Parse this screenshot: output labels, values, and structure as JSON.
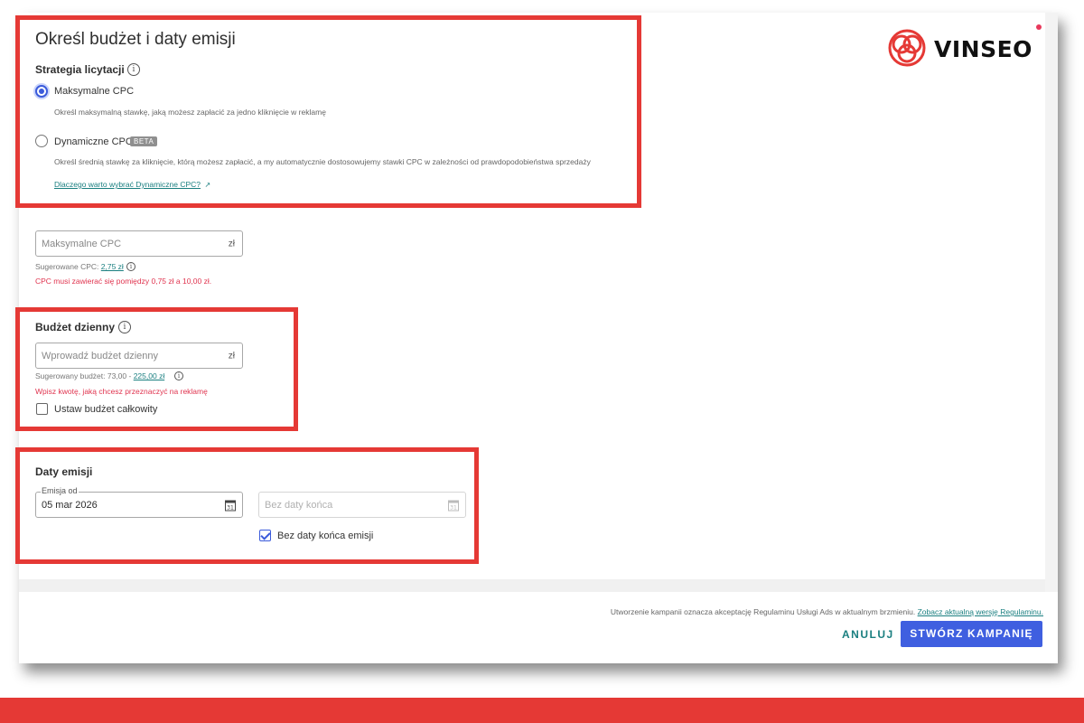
{
  "brand": {
    "name": "VINSEO",
    "accent": "#e53935",
    "dot_color": "#e8385b"
  },
  "page": {
    "title": "Określ budżet i daty emisji"
  },
  "strategy": {
    "title": "Strategia licytacji",
    "options": [
      {
        "label": "Maksymalne CPC",
        "description": "Określ maksymalną stawkę, jaką możesz zapłacić za jedno kliknięcie w reklamę",
        "selected": true
      },
      {
        "label": "Dynamiczne CPC",
        "badge": "BETA",
        "description": "Określ średnią stawkę za kliknięcie, którą możesz zapłacić, a my automatycznie dostosowujemy stawki CPC w zależności od prawdopodobieństwa sprzedaży",
        "selected": false,
        "link": "Dlaczego warto wybrać Dynamiczne CPC?"
      }
    ]
  },
  "max_cpc": {
    "placeholder": "Maksymalne CPC",
    "currency": "zł",
    "suggested_label": "Sugerowane CPC:",
    "suggested_value": "2,75 zł",
    "error": "CPC musi zawierać się pomiędzy 0,75 zł a 10,00 zł."
  },
  "daily_budget": {
    "title": "Budżet dzienny",
    "placeholder": "Wprowadź budżet dzienny",
    "currency": "zł",
    "suggested_label": "Sugerowany budżet: 73,00 -",
    "suggested_value": "225,00 zł",
    "error": "Wpisz kwotę, jaką chcesz przeznaczyć na reklamę",
    "total_checkbox_label": "Ustaw budżet całkowity",
    "total_checked": false
  },
  "dates": {
    "title": "Daty emisji",
    "start_label": "Emisja od",
    "start_value": "05 mar 2026",
    "end_placeholder": "Bez daty końca",
    "calendar_day": "31",
    "no_end_label": "Bez daty końca emisji",
    "no_end_checked": true
  },
  "footer": {
    "terms_text": "Utworzenie kampanii oznacza akceptację Regulaminu Usługi Ads w aktualnym brzmieniu.",
    "terms_link": "Zobacz aktualną wersję Regulaminu.",
    "cancel_label": "ANULUJ",
    "create_label": "STWÓRZ KAMPANIĘ"
  }
}
